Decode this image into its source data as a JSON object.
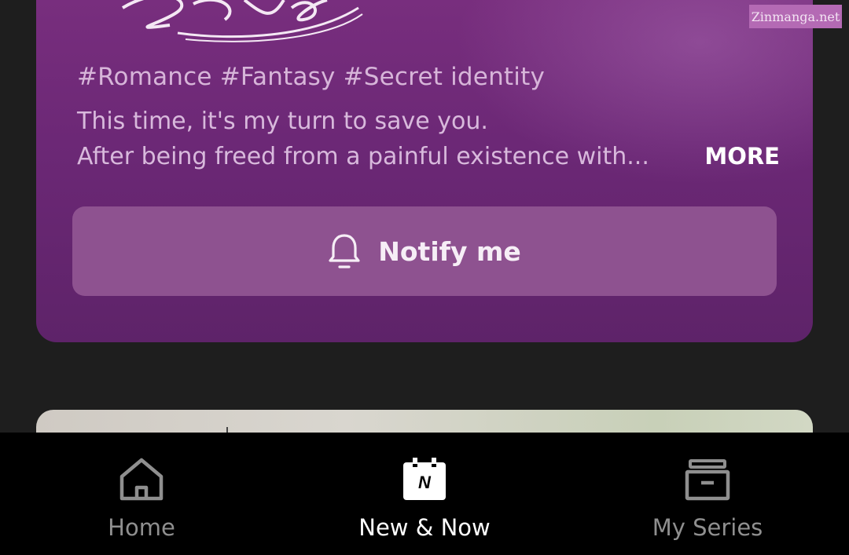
{
  "card": {
    "tags": "#Romance #Fantasy #Secret identity",
    "description_line1": "This time, it's my turn to save you.",
    "description_line2": "After being freed from a painful existence with...",
    "more_label": "MORE",
    "notify_label": "Notify me"
  },
  "watermark": "Zinmanga.net",
  "bottom_nav": {
    "items": [
      {
        "label": "Home",
        "icon": "home-icon",
        "active": false
      },
      {
        "label": "New & Now",
        "icon": "calendar-n-icon",
        "active": true
      },
      {
        "label": "My Series",
        "icon": "archive-box-icon",
        "active": false
      }
    ]
  },
  "colors": {
    "card_purple": "#6c2876",
    "notify_button": "#8e5290",
    "nav_background": "#000000",
    "active_label": "#ffffff",
    "inactive_label": "#8f8f8f"
  }
}
